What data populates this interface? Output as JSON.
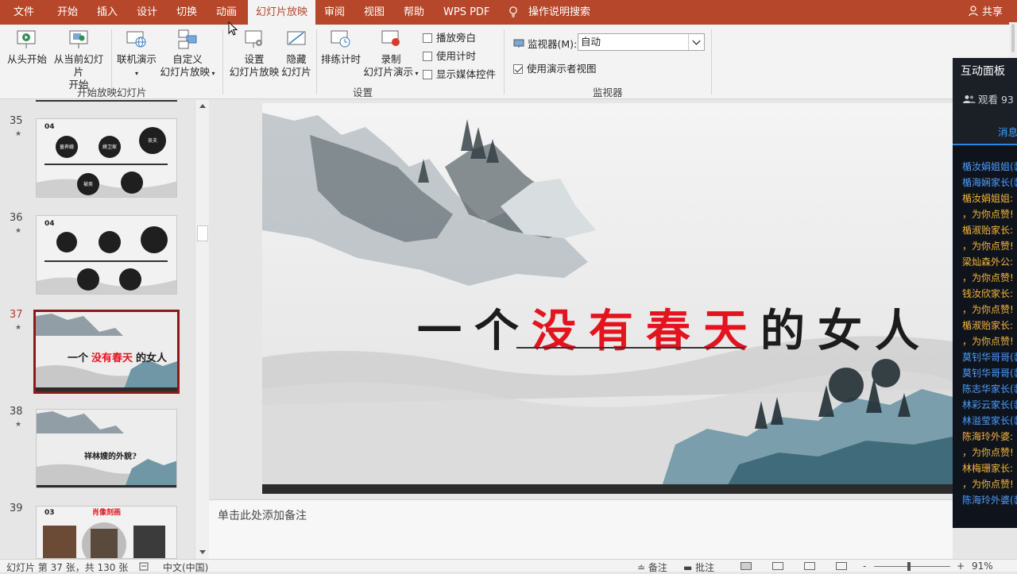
{
  "menu": {
    "items": [
      {
        "label": "文件",
        "active": false
      },
      {
        "label": "开始",
        "active": false
      },
      {
        "label": "插入",
        "active": false
      },
      {
        "label": "设计",
        "active": false
      },
      {
        "label": "切换",
        "active": false
      },
      {
        "label": "动画",
        "active": false
      },
      {
        "label": "幻灯片放映",
        "active": true
      },
      {
        "label": "审阅",
        "active": false
      },
      {
        "label": "视图",
        "active": false
      },
      {
        "label": "帮助",
        "active": false
      },
      {
        "label": "WPS PDF",
        "active": false
      }
    ],
    "tell_me": "操作说明搜索",
    "share": "共享",
    "brand_color": "#b7472a"
  },
  "ribbon": {
    "start_group": {
      "from_beginning": "从头开始",
      "from_current_1": "从当前幻灯片",
      "from_current_2": "开始",
      "online": "联机演示",
      "custom_1": "自定义",
      "custom_2": "幻灯片放映",
      "label": "开始放映幻灯片"
    },
    "setup_group": {
      "setup_1": "设置",
      "setup_2": "幻灯片放映",
      "hide_1": "隐藏",
      "hide_2": "幻灯片",
      "rehearse": "排练计时",
      "record_1": "录制",
      "record_2": "幻灯片演示",
      "play_narrations": "播放旁白",
      "use_timings": "使用计时",
      "show_media_controls": "显示媒体控件",
      "label": "设置"
    },
    "monitor_group": {
      "monitor_label": "监视器(M):",
      "monitor_value": "自动",
      "presenter_view": "使用演示者视图",
      "presenter_view_checked": true,
      "label": "监视器"
    }
  },
  "thumbnails": [
    {
      "number": "35",
      "star": "★",
      "selected": false,
      "text": "04"
    },
    {
      "number": "36",
      "star": "★",
      "selected": false,
      "text": "04"
    },
    {
      "number": "37",
      "star": "★",
      "selected": true,
      "text": "一个没有春天的女人"
    },
    {
      "number": "38",
      "star": "★",
      "selected": false,
      "text": "祥林嫂的外貌?"
    },
    {
      "number": "39",
      "star": "",
      "selected": false,
      "text": "03"
    }
  ],
  "thumb_texts": {
    "t35_nodes": [
      "童养媳",
      "嫁卫家",
      "丧夫",
      "被卖"
    ],
    "t37_black1": "一个",
    "t37_red": "没有春天",
    "t37_black2": "的女人",
    "t39_red": "肖像刻画"
  },
  "slide": {
    "title_part1": "一个",
    "title_red": "没有春天",
    "title_part2": "的女人"
  },
  "notes_placeholder": "单击此处添加备注",
  "interactive_panel": {
    "title": "互动面板",
    "viewers": "观看 93",
    "messages_tab": "消息",
    "messages": [
      {
        "text": "楯汝娟姐姐(装",
        "color": "blue"
      },
      {
        "text": "楯海娴家长(装",
        "color": "blue"
      },
      {
        "text": "楯汝娟姐姐:",
        "color": "gold"
      },
      {
        "text": "，为你点赞!",
        "color": "gold"
      },
      {
        "text": "楯淑贻家长:",
        "color": "gold"
      },
      {
        "text": "，为你点赞!",
        "color": "gold"
      },
      {
        "text": "梁灿森外公:",
        "color": "gold"
      },
      {
        "text": "，为你点赞!",
        "color": "gold"
      },
      {
        "text": "钱汝欣家长:",
        "color": "gold"
      },
      {
        "text": "，为你点赞!",
        "color": "gold"
      },
      {
        "text": "楯淑贻家长:",
        "color": "gold"
      },
      {
        "text": "，为你点赞!",
        "color": "gold"
      },
      {
        "text": "莫钊华哥哥(装",
        "color": "blue"
      },
      {
        "text": "莫钊华哥哥(装",
        "color": "blue"
      },
      {
        "text": "陈志华家长(装",
        "color": "blue"
      },
      {
        "text": "林彩云家长(装",
        "color": "blue"
      },
      {
        "text": "林溢莹家长(装",
        "color": "blue"
      },
      {
        "text": "陈海玲外婆:",
        "color": "gold"
      },
      {
        "text": "，为你点赞!",
        "color": "gold"
      },
      {
        "text": "林梅珊家长:",
        "color": "gold"
      },
      {
        "text": "，为你点赞!",
        "color": "gold"
      },
      {
        "text": "陈海玲外婆(装",
        "color": "blue"
      }
    ]
  },
  "status": {
    "slide_info": "幻灯片 第 37 张，共 130 张",
    "language": "中文(中国)",
    "notes": "备注",
    "comments": "批注",
    "zoom_minus": "-",
    "zoom_plus": "+",
    "zoom": "91%"
  }
}
